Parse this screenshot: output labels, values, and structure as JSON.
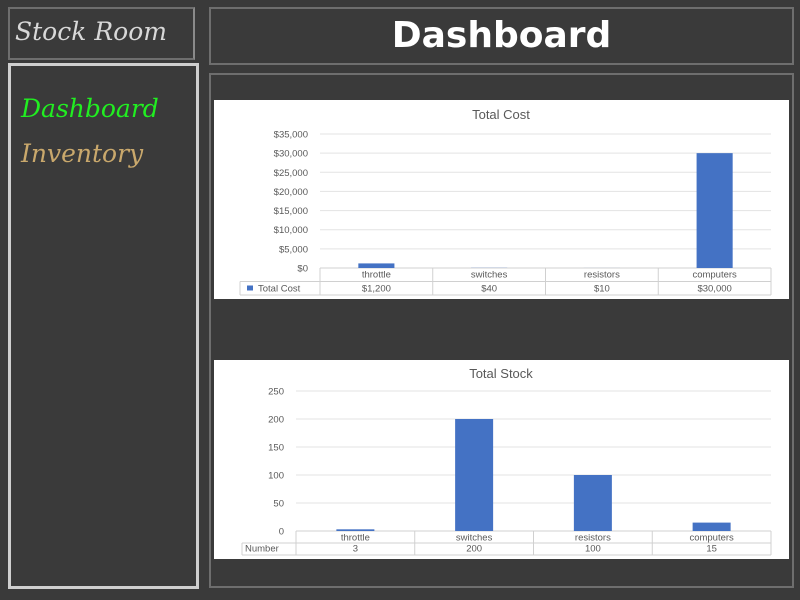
{
  "brand": {
    "title": "Stock Room"
  },
  "sidebar": {
    "items": [
      {
        "label": "Dashboard",
        "active": true,
        "color": "#21ee21"
      },
      {
        "label": "Inventory",
        "active": false,
        "color": "#c9a86c"
      }
    ]
  },
  "header": {
    "title": "Dashboard"
  },
  "colors": {
    "bar": "#4472c4",
    "background": "#3a3a3a",
    "panel_border": "#6e6e6e"
  },
  "chart_data": [
    {
      "type": "bar",
      "title": "Total Cost",
      "categories": [
        "throttle",
        "switches",
        "resistors",
        "computers"
      ],
      "series": [
        {
          "name": "Total Cost",
          "values": [
            1200,
            40,
            10,
            30000
          ]
        }
      ],
      "value_labels": [
        "$1,200",
        "$40",
        "$10",
        "$30,000"
      ],
      "yticks": [
        "$0",
        "$5,000",
        "$10,000",
        "$15,000",
        "$20,000",
        "$25,000",
        "$30,000",
        "$35,000"
      ],
      "ylim": [
        0,
        35000
      ],
      "grid": true,
      "legend": "data-table-left"
    },
    {
      "type": "bar",
      "title": "Total Stock",
      "categories": [
        "throttle",
        "switches",
        "resistors",
        "computers"
      ],
      "series": [
        {
          "name": "Number",
          "values": [
            3,
            200,
            100,
            15
          ]
        }
      ],
      "value_labels": [
        "3",
        "200",
        "100",
        "15"
      ],
      "yticks": [
        "0",
        "50",
        "100",
        "150",
        "200",
        "250"
      ],
      "ylim": [
        0,
        250
      ],
      "grid": true,
      "legend": "data-table-left"
    }
  ]
}
